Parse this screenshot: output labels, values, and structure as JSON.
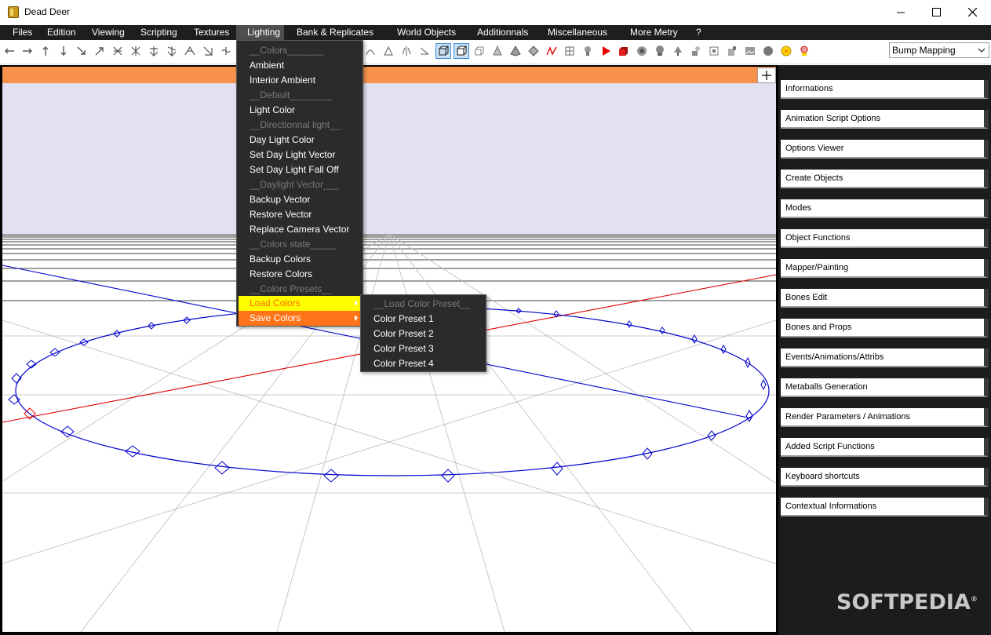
{
  "window": {
    "title": "Dead Deer",
    "controls": [
      "minimize-icon",
      "maximize-icon",
      "close-icon"
    ]
  },
  "menubar": {
    "items": [
      "Files",
      "Edition",
      "Viewing",
      "Scripting",
      "Textures",
      "Lighting",
      "Bank & Replicates",
      "World Objects",
      "Additionnals",
      "Miscellaneous",
      "More Metry",
      "?"
    ],
    "active": "Lighting"
  },
  "toolbar": {
    "render_mode": "Bump Mapping"
  },
  "lighting_menu": {
    "items": [
      {
        "label": "__Colors_______",
        "disabled": true
      },
      {
        "label": "Ambient"
      },
      {
        "label": "Interior Ambient"
      },
      {
        "label": "__Default________",
        "disabled": true
      },
      {
        "label": "Light Color"
      },
      {
        "label": "__Directionnal light__",
        "disabled": true
      },
      {
        "label": "Day Light Color"
      },
      {
        "label": "Set Day Light Vector"
      },
      {
        "label": "Set Day Light Fall Off"
      },
      {
        "label": "__Daylight Vector___",
        "disabled": true
      },
      {
        "label": "Backup Vector"
      },
      {
        "label": "Restore Vector"
      },
      {
        "label": "Replace Camera Vector"
      },
      {
        "label": "__Colors state_____",
        "disabled": true
      },
      {
        "label": "Backup Colors"
      },
      {
        "label": "Restore Colors"
      },
      {
        "label": "__Colors Presets__",
        "disabled": true
      },
      {
        "label": "Load Colors",
        "submenu": true,
        "highlight": "yellow"
      },
      {
        "label": "Save Colors",
        "submenu": true,
        "highlight": "orange"
      }
    ]
  },
  "load_colors_submenu": {
    "items": [
      {
        "label": "__Load Color Preset__",
        "disabled": true
      },
      {
        "label": "Color Preset 1"
      },
      {
        "label": "Color Preset 2"
      },
      {
        "label": "Color Preset 3"
      },
      {
        "label": "Color Preset 4"
      }
    ]
  },
  "side_panel": {
    "buttons": [
      "Informations",
      "Animation Script Options",
      "Options Viewer",
      "Create Objects",
      "Modes",
      "Object Functions",
      "Mapper/Painting",
      "Bones Edit",
      "Bones and Props",
      "Events/Animations/Attribs",
      "Metaballs Generation",
      "Render Parameters / Animations",
      "Added Script Functions",
      "Keyboard shortcuts",
      "Contextual Informations"
    ]
  },
  "viewport": {
    "plus_label": "+"
  },
  "watermark": {
    "text": "SOFTPEDIA",
    "mark": "®"
  },
  "colors": {
    "menubar_bg": "#1e1e1e",
    "orange_bar": "#f7914b",
    "sky": "#e3e0f3",
    "circle": "#0000cc",
    "axis_red": "#dd0000",
    "highlight_yellow": "#ffff00",
    "highlight_orange": "#ff7418"
  }
}
